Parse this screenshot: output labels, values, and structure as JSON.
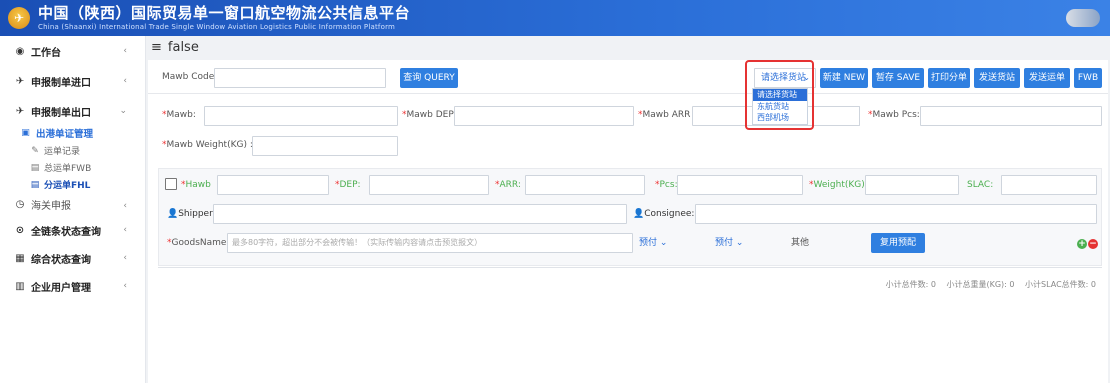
{
  "app": {
    "title": "中国（陕西）国际贸易单一窗口航空物流公共信息平台",
    "subtitle": "China (Shaanxi) International Trade Single Window Aviation Logistics Public Information Platform"
  },
  "sidebar": {
    "items": [
      {
        "label": "工作台"
      },
      {
        "label": "申报制单进口"
      },
      {
        "label": "申报制单出口"
      },
      {
        "label": "出港单证管理"
      },
      {
        "label": "运单记录"
      },
      {
        "label": "总运单FWB"
      },
      {
        "label": "分运单FHL"
      },
      {
        "label": "海关申报"
      },
      {
        "label": "全链条状态查询"
      },
      {
        "label": "综合状态查询"
      },
      {
        "label": "企业用户管理"
      }
    ]
  },
  "breadcrumb": {
    "text": "false"
  },
  "toolbar": {
    "mawb_code_label": "Mawb Code:",
    "query_button": "查询 QUERY",
    "station_select": "请选择货站",
    "station_options": [
      "请选择货站",
      "东航货站",
      "西部机场"
    ],
    "new_button": "新建 NEW",
    "save_button": "暂存 SAVE",
    "print_button": "打印分单",
    "send_station_button": "发送货站",
    "send_waybill_button": "发送运单",
    "fwb_button": "FWB"
  },
  "form": {
    "mawb_label": "Mawb:",
    "dep_label": "Mawb DEP :",
    "arr_label": "Mawb ARR :",
    "pcs_label": "Mawb Pcs:",
    "weight_label": "Mawb Weight(KG) :"
  },
  "hawb": {
    "hawb_label": "Hawb",
    "dep_label": "DEP:",
    "arr_label": "ARR:",
    "pcs_label": "Pcs:",
    "weight_label": "Weight(KG):",
    "slac_label": "SLAC:",
    "shipper_label": "Shipper:",
    "consignee_label": "Consignee:",
    "goods_label": "GoodsName:",
    "goods_placeholder": "最多80字符，超出部分不会被传输！（实际传输内容请点击预览报文）",
    "prepay1": "预付",
    "prepay2": "预付",
    "other": "其他",
    "reuse_button": "复用预配"
  },
  "summary": {
    "pieces": "小计总件数: 0",
    "weight": "小计总重量(KG): 0",
    "slac": "小计SLAC总件数: 0"
  },
  "colors": {
    "header": "#2b6fd8",
    "accent": "#2f7fe0",
    "highlight": "#e53232",
    "add": "#4caf50",
    "remove": "#e53232"
  }
}
